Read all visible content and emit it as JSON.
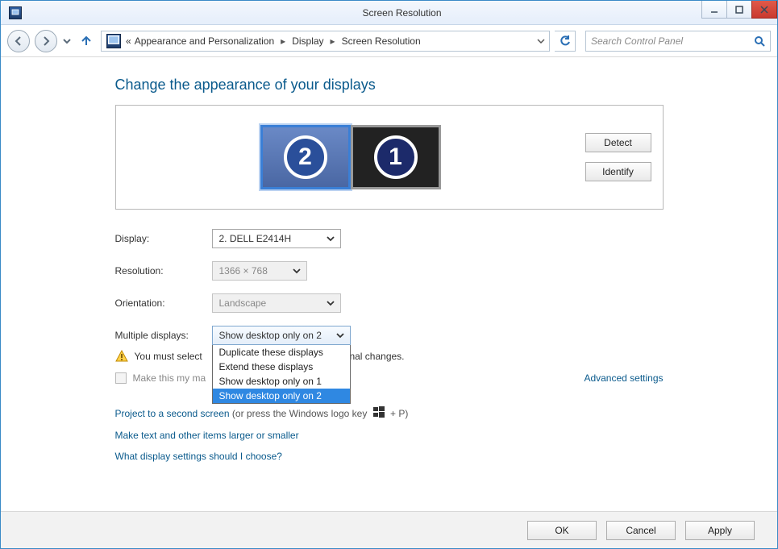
{
  "window": {
    "title": "Screen Resolution",
    "buttons": {
      "minimize": "minimize",
      "maximize": "maximize",
      "close": "close"
    }
  },
  "breadcrumb": {
    "prefix": "«",
    "parts": [
      "Appearance and Personalization",
      "Display",
      "Screen Resolution"
    ]
  },
  "search": {
    "placeholder": "Search Control Panel"
  },
  "page": {
    "heading": "Change the appearance of your displays",
    "detect": "Detect",
    "identify": "Identify",
    "monitors": [
      {
        "id": "2",
        "selected": true
      },
      {
        "id": "1",
        "selected": false
      }
    ]
  },
  "form": {
    "display_label": "Display:",
    "display_value": "2. DELL E2414H",
    "resolution_label": "Resolution:",
    "resolution_value": "1366 × 768",
    "orientation_label": "Orientation:",
    "orientation_value": "Landscape",
    "multiple_label": "Multiple displays:",
    "multiple_value": "Show desktop only on 2",
    "multiple_options": [
      "Duplicate these displays",
      "Extend these displays",
      "Show desktop only on 1",
      "Show desktop only on 2"
    ],
    "multiple_selected_index": 3
  },
  "warning": {
    "text_before": "You must select",
    "text_after": "onal changes."
  },
  "checkbox": {
    "label_before": "Make this my ma"
  },
  "advanced": "Advanced settings",
  "links": {
    "project": "Project to a second screen",
    "project_hint_before": " (or press the Windows logo key ",
    "project_hint_after": " + P)",
    "textsize": "Make text and other items larger or smaller",
    "help": "What display settings should I choose?"
  },
  "footer": {
    "ok": "OK",
    "cancel": "Cancel",
    "apply": "Apply"
  }
}
